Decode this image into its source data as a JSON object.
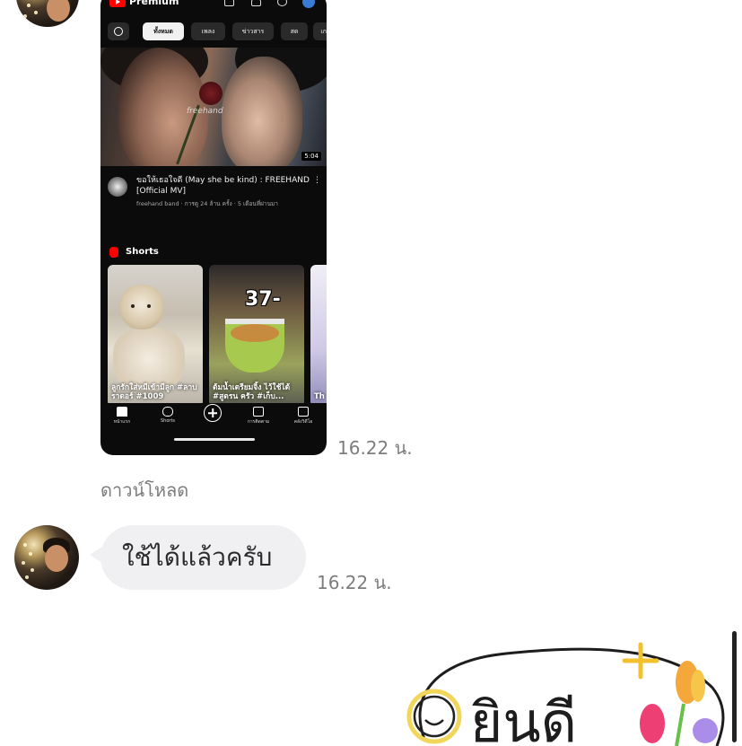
{
  "screenshot_message": {
    "app_brand": "Premium",
    "chips": [
      "ทั้งหมด",
      "เพลง",
      "ข่าวสาร",
      "สด",
      "เกม"
    ],
    "video": {
      "thumb_text": "freehand",
      "duration": "5:04",
      "title": "ขอให้เธอใจดี (May she be kind) : FREEHAND [Official MV]",
      "subtitle": "freehand band · การดู 24 ล้าน ครั้ง · 5 เดือนที่ผ่านมา"
    },
    "shorts": {
      "label": "Shorts",
      "items": [
        {
          "caption": "ลูกรักใส่หมีเข้ามีลูก #ลาบราดอร์ #1009"
        },
        {
          "number": "37-",
          "caption": "ต้มน้ำเตรียมจิ้ง ไว้ใช้ได้ #สูตรน ครัว #เก็บ..."
        },
        {
          "caption": "Th"
        }
      ]
    },
    "nav": [
      "หน้าแรก",
      "Shorts",
      "",
      "การติดตาม",
      "คลังวิดีโอ"
    ],
    "time": "16.22 น."
  },
  "download_label": "ดาวน์โหลด",
  "text_message": {
    "text": "ใช้ได้แล้วครับ",
    "time": "16.22 น."
  },
  "sticker": {
    "text": "ยินดี"
  },
  "colors": {
    "bubble": "#f0f0f2",
    "timestamp": "#7d7d7d",
    "youtube_red": "#ff0000"
  }
}
